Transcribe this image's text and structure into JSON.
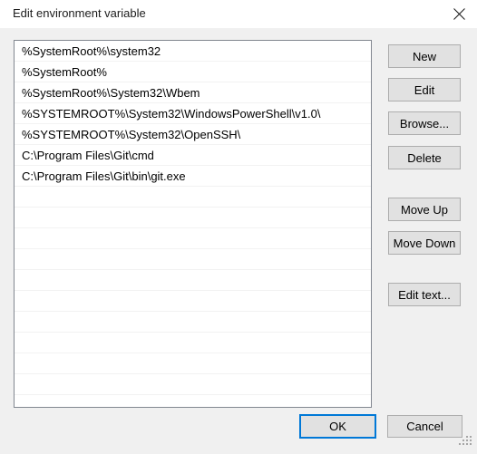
{
  "window": {
    "title": "Edit environment variable",
    "close_icon": "close-icon"
  },
  "list": {
    "entries": [
      "%SystemRoot%\\system32",
      "%SystemRoot%",
      "%SystemRoot%\\System32\\Wbem",
      "%SYSTEMROOT%\\System32\\WindowsPowerShell\\v1.0\\",
      "%SYSTEMROOT%\\System32\\OpenSSH\\",
      "C:\\Program Files\\Git\\cmd",
      "C:\\Program Files\\Git\\bin\\git.exe"
    ],
    "empty_row_count": 10
  },
  "side_buttons": {
    "new": "New",
    "edit": "Edit",
    "browse": "Browse...",
    "delete": "Delete",
    "move_up": "Move Up",
    "move_down": "Move Down",
    "edit_text": "Edit text..."
  },
  "footer": {
    "ok": "OK",
    "cancel": "Cancel"
  },
  "colors": {
    "accent": "#0078d7",
    "dialog_background": "#f0f0f0",
    "titlebar_background": "#ffffff",
    "list_background": "#ffffff",
    "button_face": "#e1e1e1",
    "button_border": "#adadad",
    "list_border": "#828790",
    "row_separator": "#f2f2f2",
    "text": "#000000"
  }
}
